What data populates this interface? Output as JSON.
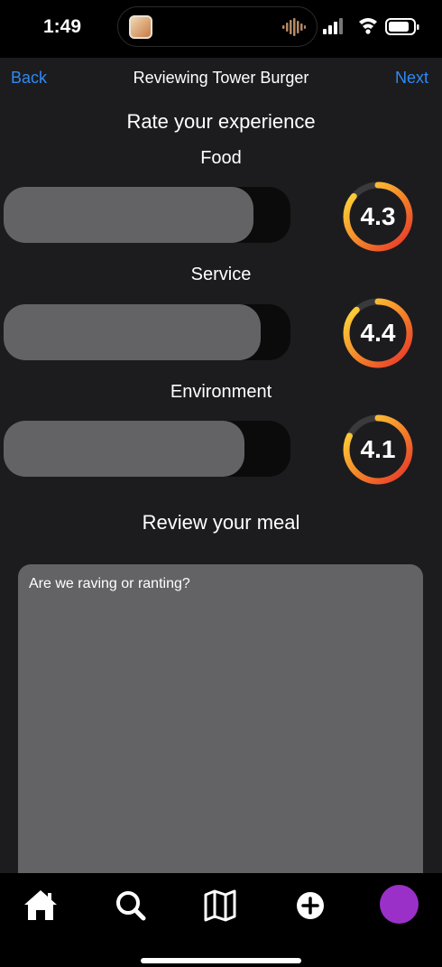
{
  "status": {
    "time": "1:49"
  },
  "nav": {
    "back_label": "Back",
    "title": "Reviewing Tower Burger",
    "next_label": "Next"
  },
  "rating_section": {
    "heading": "Rate your experience",
    "categories": [
      {
        "label": "Food",
        "value": 4.3,
        "display": "4.3",
        "fill_fraction": 0.87
      },
      {
        "label": "Service",
        "value": 4.4,
        "display": "4.4",
        "fill_fraction": 0.895
      },
      {
        "label": "Environment",
        "value": 4.1,
        "display": "4.1",
        "fill_fraction": 0.84
      }
    ]
  },
  "review": {
    "heading": "Review your meal",
    "placeholder": "Are we raving or ranting?",
    "value": ""
  },
  "tab_bar": {
    "items": [
      {
        "name": "home-icon"
      },
      {
        "name": "search-icon"
      },
      {
        "name": "map-icon"
      },
      {
        "name": "add-icon"
      },
      {
        "name": "profile-avatar",
        "color": "#9b30c8"
      }
    ]
  },
  "colors": {
    "accent": "#2f8af5",
    "ring_start": "#e8302a",
    "ring_end": "#ffe23c",
    "avatar": "#9b30c8"
  }
}
